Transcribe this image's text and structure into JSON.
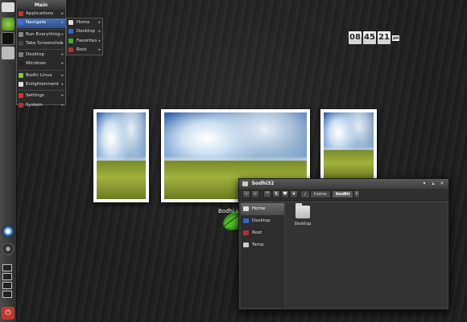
{
  "menu": {
    "title": "Main",
    "items": [
      {
        "label": "Applications",
        "icon": "applications-icon",
        "color": "#c0392b"
      },
      {
        "label": "Navigate",
        "icon": "navigate-icon",
        "color": "#3b6fd6",
        "active": true
      },
      {
        "label": "Run Everything",
        "icon": "run-icon",
        "color": "#888888"
      },
      {
        "label": "Take Screenshot",
        "icon": "camera-icon",
        "color": "#444444"
      },
      {
        "label": "Desktop",
        "icon": "desktop-icon",
        "color": "#7a7a7a"
      },
      {
        "label": "Windows",
        "icon": "windows-icon",
        "color": "#222222"
      },
      {
        "label": "Bodhi Linux",
        "icon": "bodhi-icon",
        "color": "#8bc34a"
      },
      {
        "label": "Enlightenment",
        "icon": "enlightenment-icon",
        "color": "#dddddd"
      },
      {
        "label": "Settings",
        "icon": "settings-icon",
        "color": "#cc3333"
      },
      {
        "label": "System",
        "icon": "system-icon",
        "color": "#b03030"
      }
    ]
  },
  "submenu": {
    "items": [
      {
        "label": "Home",
        "icon": "home-icon",
        "color": "#dddddd"
      },
      {
        "label": "Desktop",
        "icon": "desktop-folder-icon",
        "color": "#3366cc"
      },
      {
        "label": "Favorites",
        "icon": "favorites-icon",
        "color": "#44aa33"
      },
      {
        "label": "Root",
        "icon": "root-icon",
        "color": "#aa3333"
      }
    ]
  },
  "clock": {
    "hh": "08",
    "mm": "45",
    "ss": "21",
    "ampm": "AM"
  },
  "desktop": {
    "logo_label": "Bodhi Li"
  },
  "filemanager": {
    "title": "bodhi32",
    "crumbs": [
      "/",
      "home",
      "bodhi"
    ],
    "places": [
      {
        "label": "Home",
        "icon": "home-icon",
        "selected": true
      },
      {
        "label": "Desktop",
        "icon": "desktop-folder-icon"
      },
      {
        "label": "Root",
        "icon": "root-icon"
      },
      {
        "label": "Temp",
        "icon": "temp-icon"
      }
    ],
    "folder": "Desktop",
    "window_buttons": [
      "▾",
      "▴",
      "✕"
    ]
  }
}
